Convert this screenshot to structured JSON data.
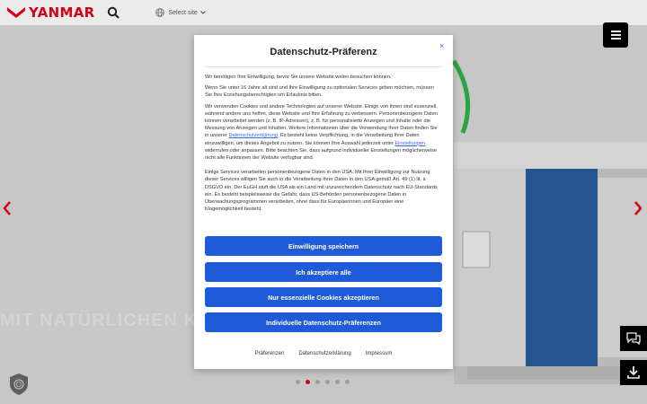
{
  "header": {
    "logo_text": "YANMAR",
    "site_select_label": "Select site",
    "brand_color": "#e3051b"
  },
  "hero": {
    "slogan": "MIT NATÜRLICHEN KÄLTEMITTELN",
    "slide_count": 6,
    "active_slide": 2
  },
  "modal": {
    "title": "Datenschutz-Präferenz",
    "close_label": "×",
    "paragraphs": {
      "p1": "Wir benötigen Ihre Einwilligung, bevor Sie unsere Website weiter besuchen können.",
      "p2": "Wenn Sie unter 16 Jahre alt sind und Ihre Einwilligung zu optionalen Services geben möchten, müssen Sie Ihre Erziehungsberechtigten um Erlaubnis bitten.",
      "p3_before_link": "Wir verwenden Cookies und andere Technologien auf unserer Website. Einige von ihnen sind essenziell, während andere uns helfen, diese Website und Ihre Erfahrung zu verbessern. Personenbezogene Daten können verarbeitet werden (z. B. IP-Adressen), z. B. für personalisierte Anzeigen und Inhalte oder die Messung von Anzeigen und Inhalten. Weitere Informationen über die Verwendung Ihrer Daten finden Sie in unserer ",
      "p3_link": "Datenschutzerklärung",
      "p3_middle": ". Es besteht keine Verpflichtung, in die Verarbeitung Ihrer Daten einzuwilligen, um dieses Angebot zu nutzen. Sie können Ihre Auswahl jederzeit unter ",
      "p3_link2": "Einstellungen",
      "p3_after": " widerrufen oder anpassen. Bitte beachten Sie, dass aufgrund individueller Einstellungen möglicherweise nicht alle Funktionen der Website verfügbar sind.",
      "p4": "Einige Services verarbeiten personenbezogene Daten in den USA. Mit Ihrer Einwilligung zur Nutzung dieser Services willigen Sie auch in die Verarbeitung Ihrer Daten in den USA gemäß Art. 49 (1) lit. a DSGVO ein. Der EuGH stuft die USA als ein Land mit unzureichendem Datenschutz nach EU-Standards ein. Es besteht beispielsweise die Gefahr, dass US-Behörden personenbezogene Daten in Überwachungsprogrammen verarbeiten, ohne dass für Europäerinnen und Europäer eine Klagemöglichkeit besteht."
    },
    "buttons": {
      "save_consent": "Einwilligung speichern",
      "accept_all": "Ich akzeptiere alle",
      "essential_only": "Nur essenzielle Cookies akzeptieren",
      "individual": "Individuelle Datenschutz-Präferenzen"
    },
    "footer_links": {
      "preferences": "Präferenzen",
      "privacy": "Datenschutzerklärung",
      "imprint": "Impressum"
    },
    "button_color": "#1f5bd8"
  }
}
